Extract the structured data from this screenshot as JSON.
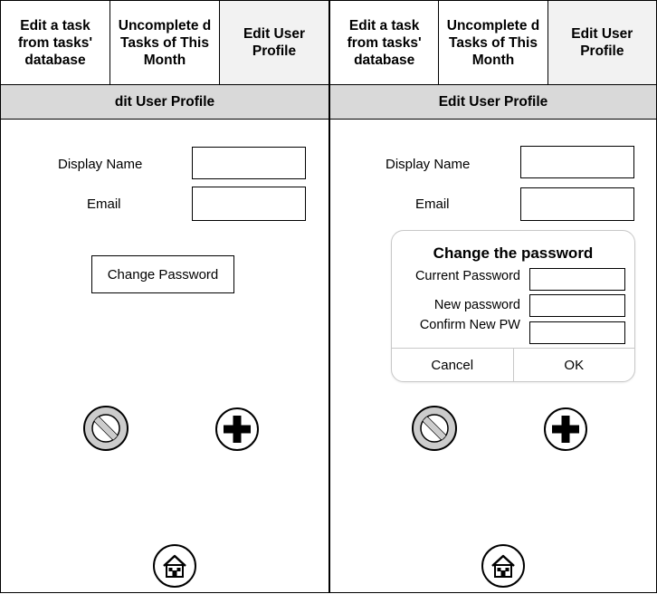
{
  "left_screen": {
    "tabs": [
      {
        "label": "Edit a task from tasks' database"
      },
      {
        "label": "Uncomplete d Tasks of This Month"
      },
      {
        "label": "Edit User Profile"
      }
    ],
    "title": "dit User Profile",
    "display_name_label": "Display Name",
    "email_label": "Email",
    "change_password_button": "Change Password"
  },
  "right_screen": {
    "tabs": [
      {
        "label": "Edit a task from tasks' database"
      },
      {
        "label": "Uncomplete d Tasks of This Month"
      },
      {
        "label": "Edit User Profile"
      }
    ],
    "title": "Edit User Profile",
    "display_name_label": "Display Name",
    "email_label": "Email",
    "dialog": {
      "title": "Change the password",
      "current_password_label": "Current Password",
      "new_password_label": "New password",
      "confirm_password_label": "Confirm New PW",
      "cancel_label": "Cancel",
      "ok_label": "OK"
    }
  },
  "icons": {
    "cancel": "no-entry-circle",
    "add": "plus-circle",
    "home": "home-building"
  },
  "colors": {
    "header_bar": "#d9d9d9",
    "active_tab": "#f2f2f2",
    "cancel_icon_fill": "#cccccc",
    "icon_outline": "#000000"
  }
}
